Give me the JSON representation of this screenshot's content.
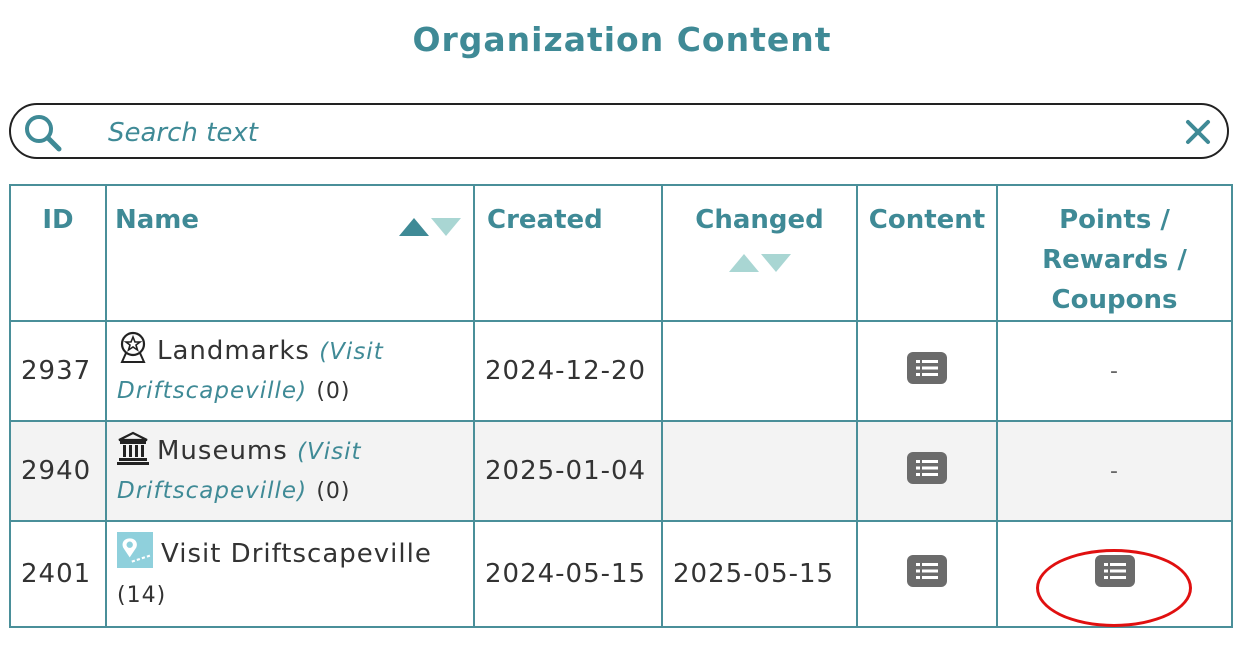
{
  "page": {
    "title": "Organization Content"
  },
  "search": {
    "placeholder": "Search text"
  },
  "table": {
    "headers": {
      "id": "ID",
      "name": "Name",
      "created": "Created",
      "changed": "Changed",
      "content": "Content",
      "points_line1": "Points /",
      "points_line2": "Rewards /",
      "points_line3": "Coupons"
    },
    "rows": [
      {
        "id": "2937",
        "name": "Landmarks",
        "link": "(Visit Driftscapeville)",
        "count": "(0)",
        "created": "2024-12-20",
        "changed": "",
        "points": "-",
        "icon": "landmark-badge-icon"
      },
      {
        "id": "2940",
        "name": "Museums",
        "link": "(Visit Driftscapeville)",
        "count": "(0)",
        "created": "2025-01-04",
        "changed": "",
        "points": "-",
        "icon": "museum-building-icon"
      },
      {
        "id": "2401",
        "name": "Visit Driftscapeville",
        "link": "",
        "count": "(14)",
        "created": "2024-05-15",
        "changed": "2025-05-15",
        "points": "",
        "icon": "map-pin-tile-icon"
      }
    ]
  },
  "colors": {
    "accent": "#3f8a96",
    "border": "#4a8f99",
    "highlight": "#e01010",
    "icon_gray": "#6b6b6b"
  }
}
